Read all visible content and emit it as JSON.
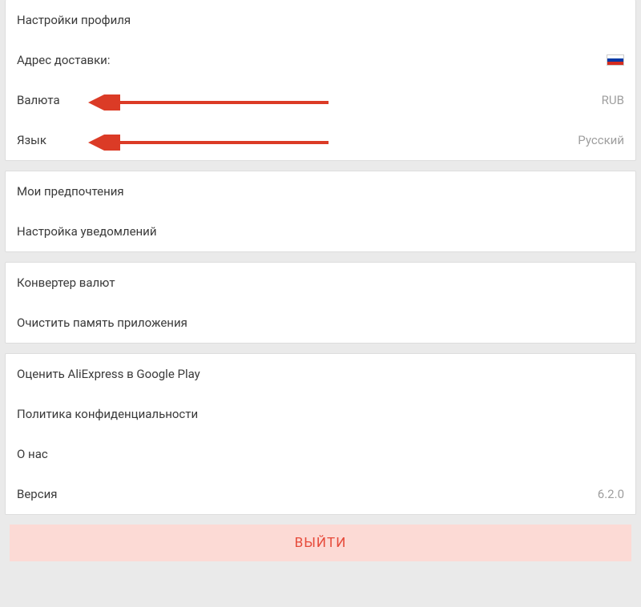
{
  "group_profile": {
    "title": "Настройки профиля",
    "shipping": {
      "label": "Адрес доставки:",
      "value_icon": "flag-ru"
    },
    "currency": {
      "label": "Валюта",
      "value": "RUB"
    },
    "language": {
      "label": "Язык",
      "value": "Русский"
    }
  },
  "group_prefs": {
    "prefs": "Мои предпочтения",
    "notifications": "Настройка уведомлений"
  },
  "group_tools": {
    "converter": "Конвертер валют",
    "clear_cache": "Очистить память приложения"
  },
  "group_about": {
    "rate": "Оценить AliExpress в Google Play",
    "privacy": "Политика конфиденциальности",
    "about": "О нас",
    "version_label": "Версия",
    "version_value": "6.2.0"
  },
  "logout": "ВЫЙТИ"
}
